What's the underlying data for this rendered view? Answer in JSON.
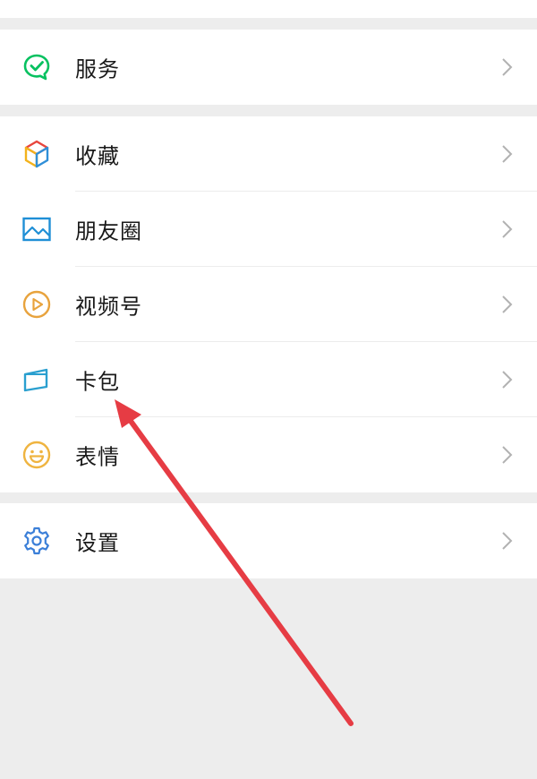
{
  "menu": {
    "services": {
      "label": "服务",
      "icon": "wechat-pay-check-icon"
    },
    "favorites": {
      "label": "收藏",
      "icon": "cube-icon"
    },
    "moments": {
      "label": "朋友圈",
      "icon": "picture-icon"
    },
    "channels": {
      "label": "视频号",
      "icon": "play-circle-icon"
    },
    "cards": {
      "label": "卡包",
      "icon": "card-icon"
    },
    "stickers": {
      "label": "表情",
      "icon": "smiley-icon"
    },
    "settings": {
      "label": "设置",
      "icon": "gear-icon"
    }
  },
  "colors": {
    "background": "#ededed",
    "row_background": "#ffffff",
    "label": "#191919",
    "chevron": "#b2b2b2",
    "annotation_arrow": "#e63c44",
    "services_icon": "#07c160",
    "moments_icon": "#1f8fd6",
    "channels_icon": "#e8a33d",
    "cards_icon": "#2a9fcf",
    "stickers_icon": "#efb440",
    "settings_icon": "#3b7fd8"
  }
}
